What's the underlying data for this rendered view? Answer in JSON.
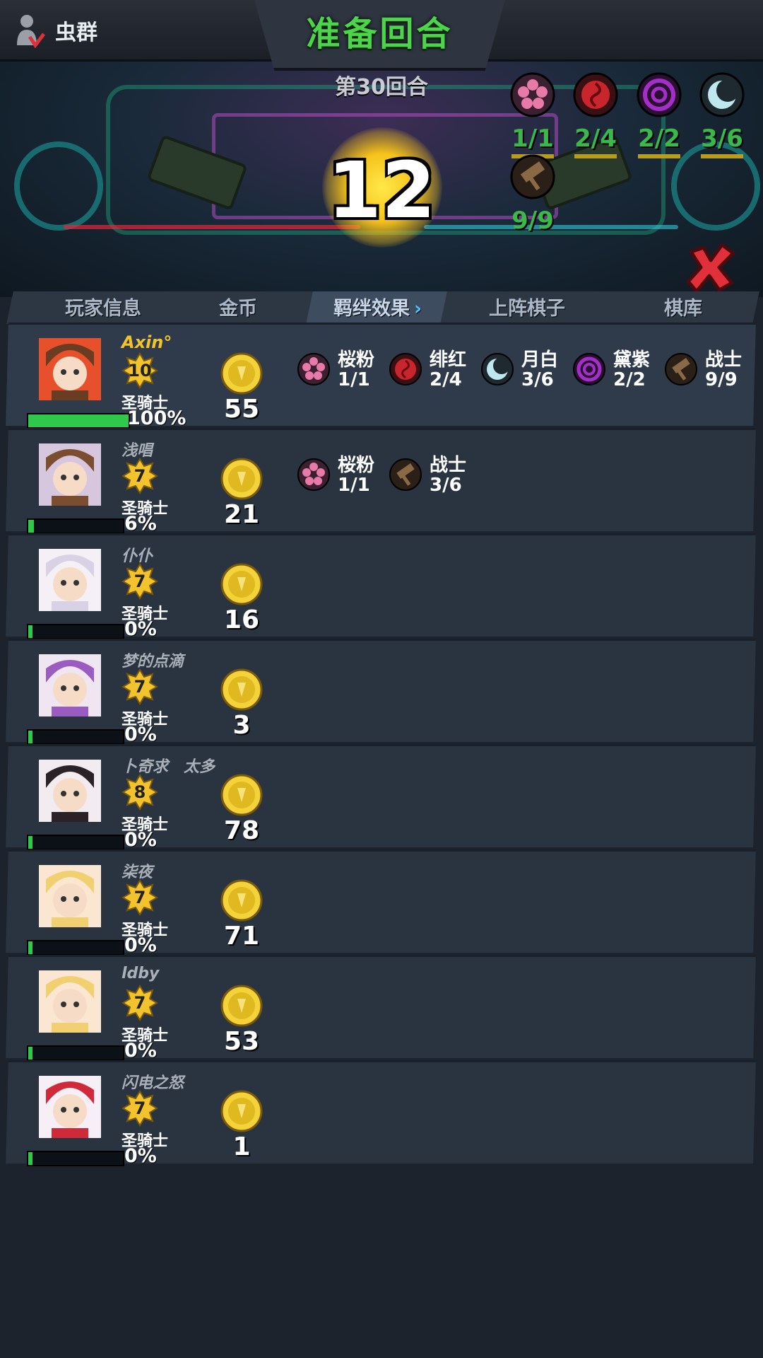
{
  "header": {
    "faction": "虫群",
    "phase": "准备回合",
    "round": "第30回合",
    "timer": "12"
  },
  "top_icons": [
    "phone-swap-icon",
    "card-deck-icon",
    "gear-icon",
    "signal-icon"
  ],
  "top_synergies": [
    {
      "icon": "sakura-icon",
      "count": "1/1",
      "color": "#e77aa9"
    },
    {
      "icon": "rose-icon",
      "count": "2/4",
      "color": "#c8252c"
    },
    {
      "icon": "swirl-icon",
      "count": "2/2",
      "color": "#a42fc8"
    },
    {
      "icon": "moon-icon",
      "count": "3/6",
      "color": "#bfe7ef"
    },
    {
      "icon": "hammer-icon",
      "count": "9/9",
      "color": "#8a6a46"
    }
  ],
  "tabs": [
    "玩家信息",
    "金币",
    "羁绊效果",
    "上阵棋子",
    "棋库"
  ],
  "players": [
    {
      "name": "Axin°",
      "level": "10",
      "class": "圣骑士",
      "gold": "55",
      "hp": "100%",
      "hp_fraction": 1.0,
      "avatar": "monkey-goggles",
      "me": true,
      "synergies": [
        {
          "icon": "sakura-icon",
          "name": "桜粉",
          "count": "1/1"
        },
        {
          "icon": "rose-icon",
          "name": "绯红",
          "count": "2/4"
        },
        {
          "icon": "moon-icon",
          "name": "月白",
          "count": "3/6"
        },
        {
          "icon": "swirl-icon",
          "name": "黛紫",
          "count": "2/2"
        },
        {
          "icon": "hammer-icon",
          "name": "战士",
          "count": "9/9"
        }
      ]
    },
    {
      "name": "浅唱",
      "level": "7",
      "class": "圣骑士",
      "gold": "21",
      "hp": "6%",
      "hp_fraction": 0.06,
      "avatar": "monkey",
      "synergies": [
        {
          "icon": "sakura-icon",
          "name": "桜粉",
          "count": "1/1"
        },
        {
          "icon": "hammer-icon",
          "name": "战士",
          "count": "3/6"
        }
      ]
    },
    {
      "name": "仆仆",
      "level": "7",
      "class": "圣骑士",
      "gold": "16",
      "hp": "0%",
      "hp_fraction": 0.0,
      "avatar": "white-hair",
      "synergies": []
    },
    {
      "name": "梦的点滴",
      "level": "7",
      "class": "圣骑士",
      "gold": "3",
      "hp": "0%",
      "hp_fraction": 0.0,
      "avatar": "purple-hair",
      "synergies": []
    },
    {
      "name": "卜奇求　太多",
      "level": "8",
      "class": "圣骑士",
      "gold": "78",
      "hp": "0%",
      "hp_fraction": 0.0,
      "avatar": "hood",
      "synergies": []
    },
    {
      "name": "柒夜",
      "level": "7",
      "class": "圣骑士",
      "gold": "71",
      "hp": "0%",
      "hp_fraction": 0.0,
      "avatar": "blond",
      "synergies": []
    },
    {
      "name": "ldby",
      "level": "7",
      "class": "圣骑士",
      "gold": "53",
      "hp": "0%",
      "hp_fraction": 0.0,
      "avatar": "blond",
      "synergies": []
    },
    {
      "name": "闪电之怒",
      "level": "7",
      "class": "圣骑士",
      "gold": "1",
      "hp": "0%",
      "hp_fraction": 0.0,
      "avatar": "red-hair",
      "synergies": []
    }
  ]
}
